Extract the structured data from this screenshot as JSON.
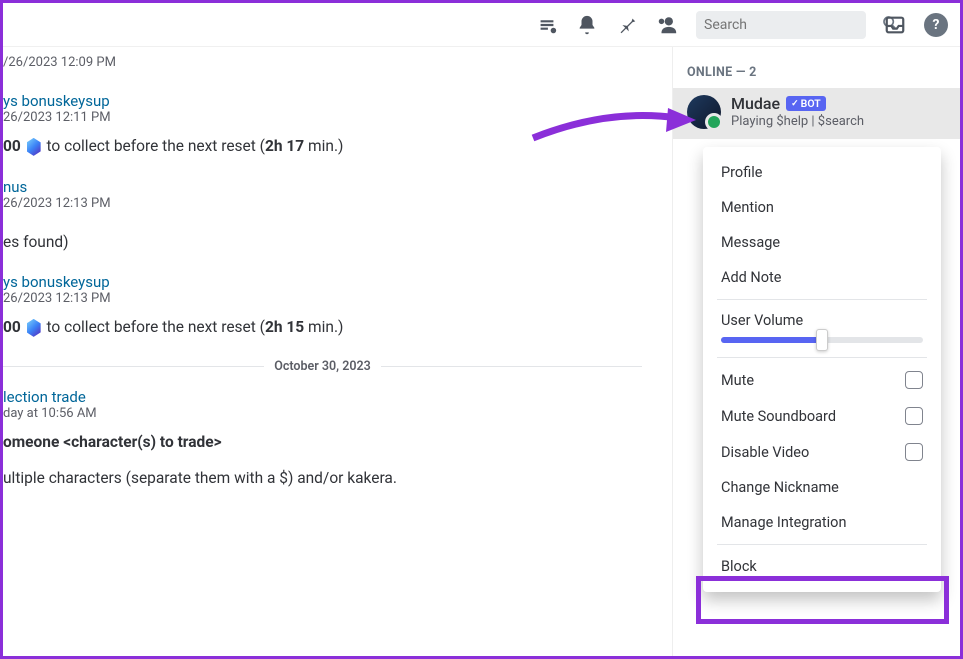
{
  "header": {
    "search_placeholder": "Search"
  },
  "messages": [
    {
      "timestamp": "/26/2023 12:09 PM"
    },
    {
      "link": "ys bonuskeysup",
      "timestamp": "26/2023 12:11 PM",
      "before": "00 ",
      "mid": " to collect before the next reset (",
      "bold": "2h 17",
      "after": " min.)"
    },
    {
      "link": "nus",
      "timestamp": "26/2023 12:13 PM"
    },
    {
      "content": "es found)"
    },
    {
      "link": "ys bonuskeysup",
      "timestamp": "26/2023 12:13 PM",
      "before": "00 ",
      "mid": " to collect before the next reset (",
      "bold": "2h 15",
      "after": " min.)"
    }
  ],
  "divider_date": "October 30, 2023",
  "trade": {
    "link": "lection trade",
    "timestamp": "day at 10:56 AM",
    "bold_line": "omeone <character(s) to trade>",
    "desc": "ultiple characters (separate them with a $) and/or kakera."
  },
  "members": {
    "online_label": "ONLINE — 2",
    "name": "Mudae",
    "bot_label": "BOT",
    "status": "Playing $help | $search"
  },
  "menu": {
    "profile": "Profile",
    "mention": "Mention",
    "message": "Message",
    "add_note": "Add Note",
    "user_volume": "User Volume",
    "mute": "Mute",
    "mute_soundboard": "Mute Soundboard",
    "disable_video": "Disable Video",
    "change_nickname": "Change Nickname",
    "manage_integration": "Manage Integration",
    "block": "Block"
  }
}
